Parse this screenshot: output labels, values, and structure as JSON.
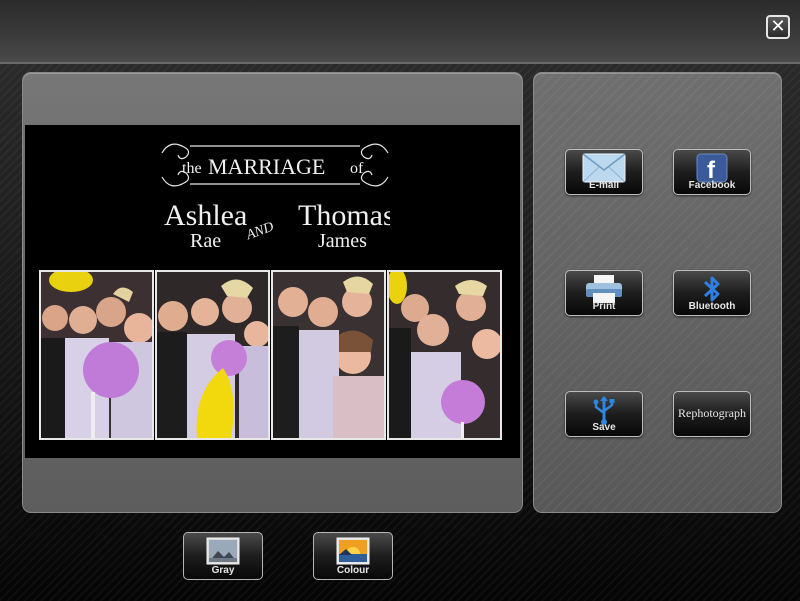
{
  "window": {
    "close_label": "✕"
  },
  "photo": {
    "header": {
      "line1_small": "the",
      "line1_big": "MARRIAGE",
      "line1_tail": "of",
      "bride_first": "Ashlea",
      "bride_last": "Rae",
      "conjunction": "AND",
      "groom_first": "Thomas",
      "groom_last": "James"
    },
    "frame_count": 4
  },
  "share": {
    "email_label": "E-mail",
    "facebook_label": "Facebook",
    "facebook_glyph": "f",
    "print_label": "Print",
    "bluetooth_label": "Bluetooth",
    "save_label": "Save",
    "rephotograph_label": "Rephotograph"
  },
  "filters": {
    "gray_label": "Gray",
    "colour_label": "Colour"
  }
}
